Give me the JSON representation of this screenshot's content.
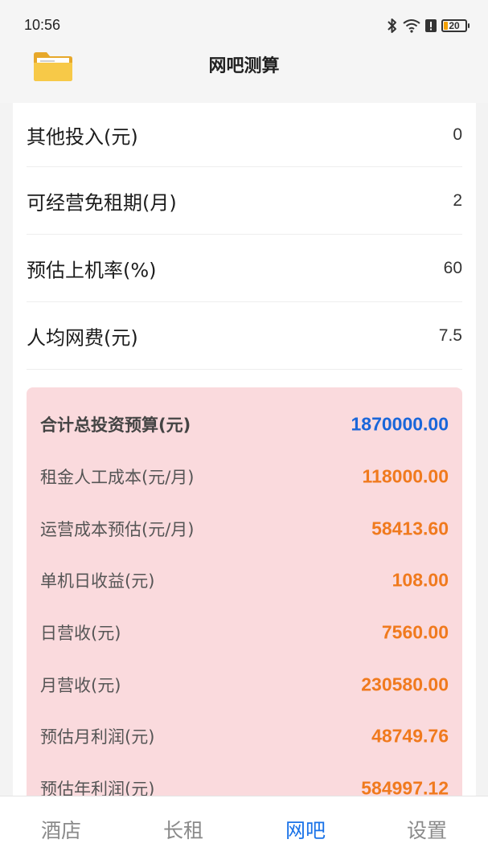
{
  "status_bar": {
    "time": "10:56",
    "battery": "20",
    "icons": [
      "bluetooth-icon",
      "wifi-icon",
      "alert-icon",
      "battery-icon"
    ]
  },
  "app_bar": {
    "title": "网吧测算",
    "logo_icon": "folder-icon"
  },
  "form": {
    "rows": [
      {
        "label": "其他投入(元)",
        "value": "0"
      },
      {
        "label": "可经营免租期(月)",
        "value": "2"
      },
      {
        "label": "预估上机率(%)",
        "value": "60"
      },
      {
        "label": "人均网费(元)",
        "value": "7.5"
      }
    ]
  },
  "summary": {
    "background": "#fadadd",
    "total_color": "#1a66d9",
    "value_color": "#f07a1e",
    "rows": [
      {
        "label": "合计总投资预算(元)",
        "value": "1870000.00"
      },
      {
        "label": "租金人工成本(元/月)",
        "value": "118000.00"
      },
      {
        "label": "运营成本预估(元/月)",
        "value": "58413.60"
      },
      {
        "label": "单机日收益(元)",
        "value": "108.00"
      },
      {
        "label": "日营收(元)",
        "value": "7560.00"
      },
      {
        "label": "月营收(元)",
        "value": "230580.00"
      },
      {
        "label": "预估月利润(元)",
        "value": "48749.76"
      },
      {
        "label": "预估年利润(元)",
        "value": "584997.12"
      }
    ]
  },
  "bottom_nav": {
    "active_color": "#1a73e8",
    "items": [
      {
        "label": "酒店"
      },
      {
        "label": "长租"
      },
      {
        "label": "网吧"
      },
      {
        "label": "设置"
      }
    ],
    "active_index": 2
  }
}
